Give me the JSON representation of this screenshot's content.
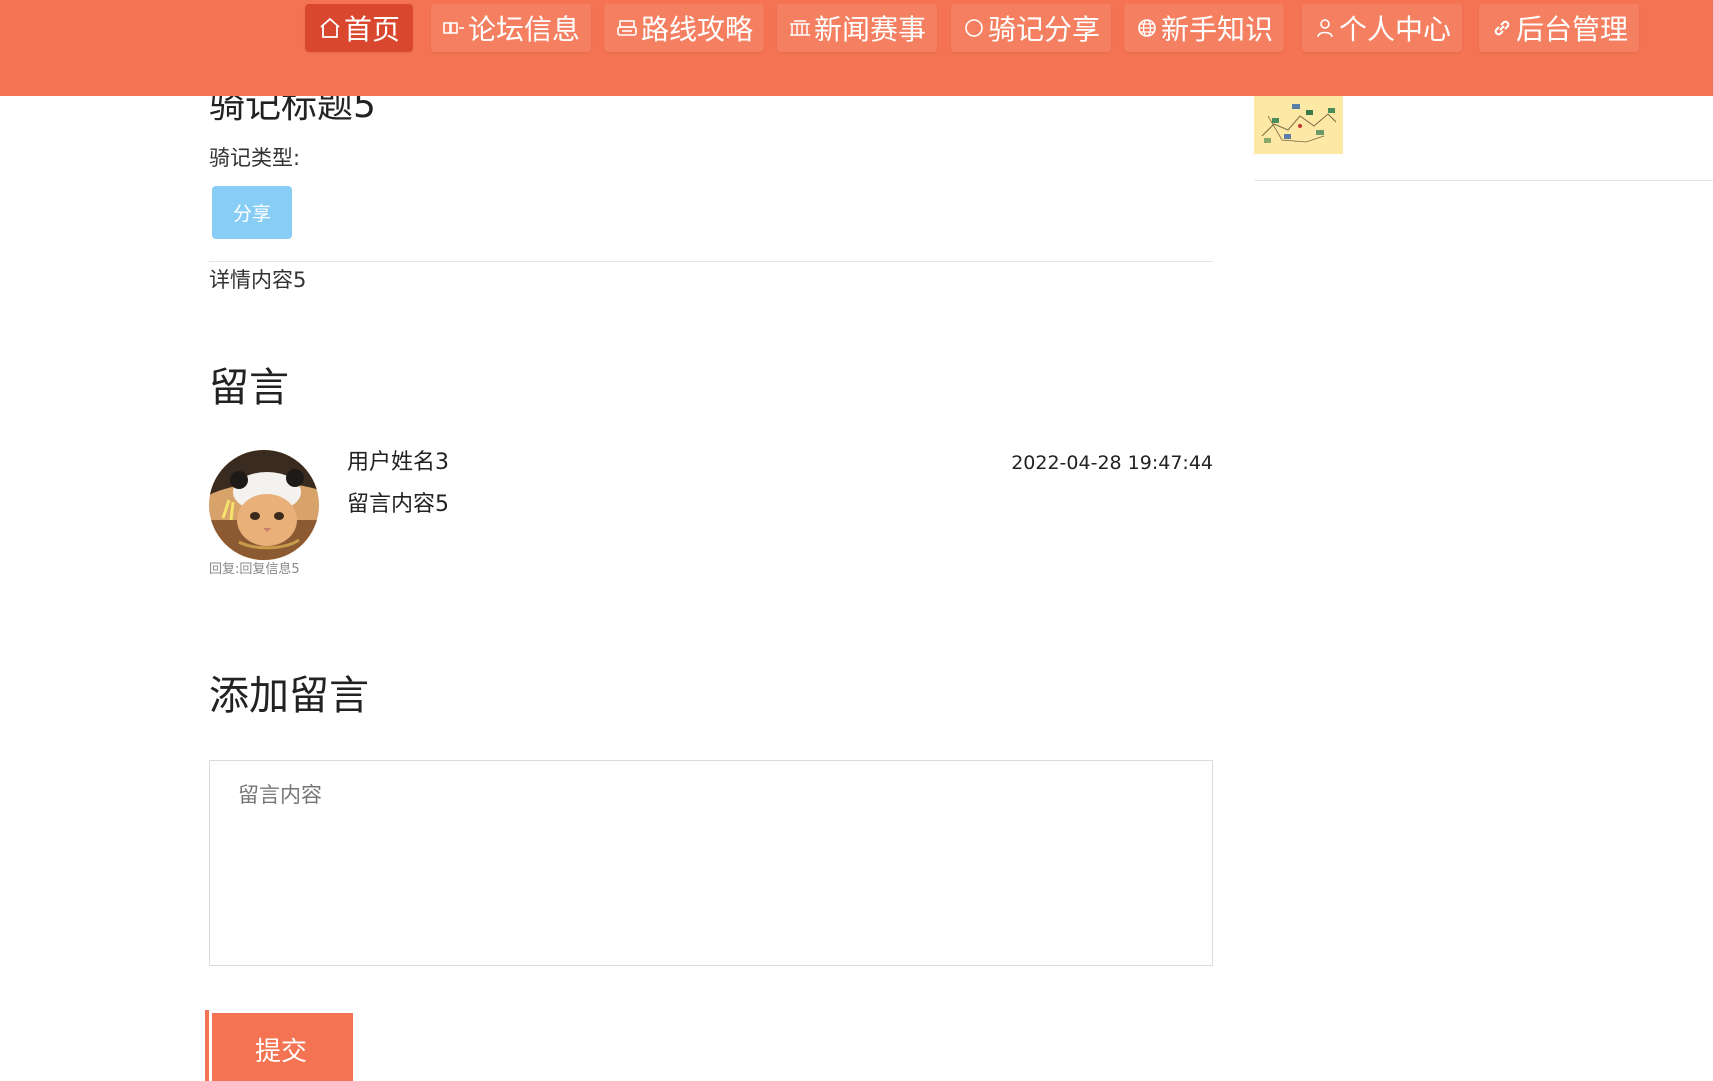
{
  "nav": {
    "items": [
      {
        "label": "首页",
        "icon": "home-icon",
        "active": true
      },
      {
        "label": "论坛信息",
        "icon": "forum-icon",
        "active": false
      },
      {
        "label": "路线攻略",
        "icon": "route-icon",
        "active": false
      },
      {
        "label": "新闻赛事",
        "icon": "news-icon",
        "active": false
      },
      {
        "label": "骑记分享",
        "icon": "share-icon",
        "active": false
      },
      {
        "label": "新手知识",
        "icon": "globe-icon",
        "active": false
      },
      {
        "label": "个人中心",
        "icon": "user-icon",
        "active": false
      },
      {
        "label": "后台管理",
        "icon": "link-icon",
        "active": false
      }
    ]
  },
  "post": {
    "title": "骑记标题5",
    "type_label": "骑记类型:",
    "type_value": "分享",
    "content": "详情内容5"
  },
  "comments": {
    "title": "留言",
    "items": [
      {
        "user": "用户姓名3",
        "text": "留言内容5",
        "time": "2022-04-28 19:47:44",
        "reply": "回复:回复信息5"
      }
    ]
  },
  "add_comment": {
    "title": "添加留言",
    "placeholder": "留言内容",
    "value": "",
    "submit_label": "提交"
  },
  "colors": {
    "nav_bg": "#f37352",
    "nav_active": "#d9482e",
    "badge": "#87cdf5",
    "submit": "#f37352"
  }
}
